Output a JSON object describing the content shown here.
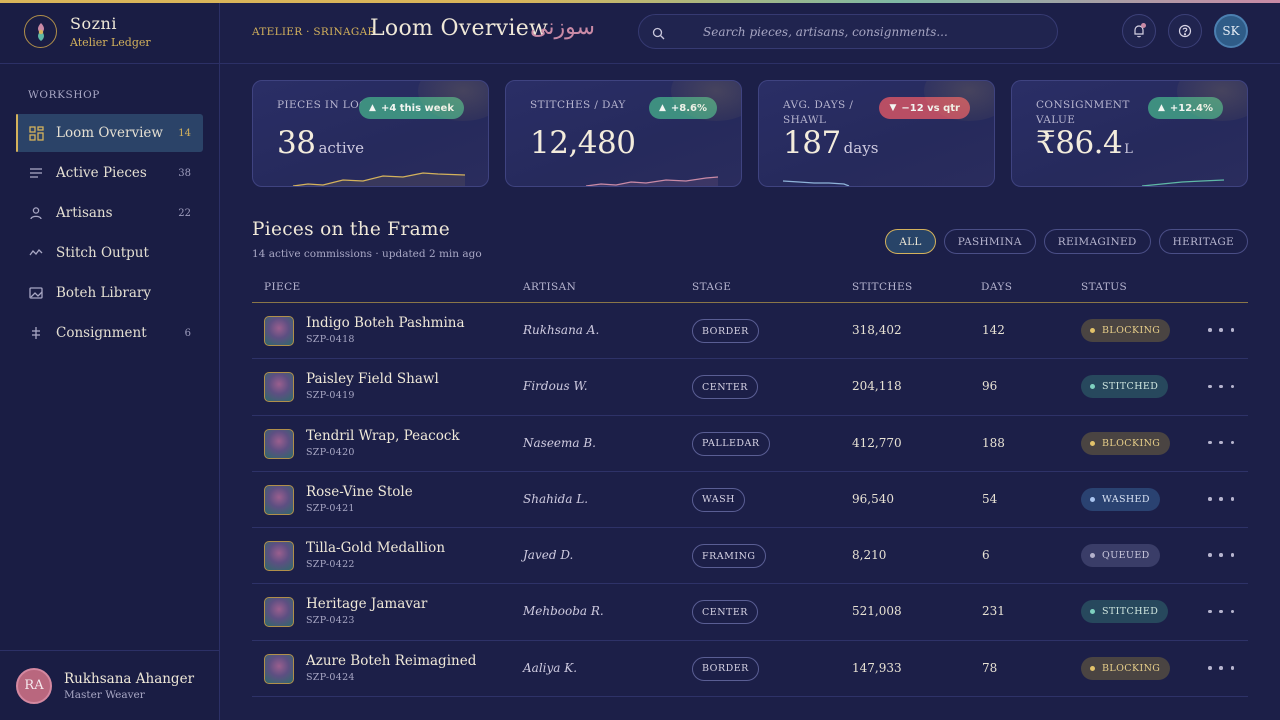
{
  "brand": {
    "name": "Sozni",
    "subtitle": "Atelier Ledger"
  },
  "sidebar": {
    "section": "WORKSHOP",
    "items": [
      {
        "label": "Loom Overview",
        "count": "14",
        "icon": "grid-icon",
        "active": true
      },
      {
        "label": "Active Pieces",
        "count": "38",
        "icon": "list-icon"
      },
      {
        "label": "Artisans",
        "count": "22",
        "icon": "user-icon"
      },
      {
        "label": "Stitch Output",
        "count": "",
        "icon": "wave-icon"
      },
      {
        "label": "Boteh Library",
        "count": "",
        "icon": "image-icon"
      },
      {
        "label": "Consignment",
        "count": "6",
        "icon": "scale-icon"
      }
    ]
  },
  "user": {
    "initials": "RA",
    "name": "Rukhsana Ahanger",
    "role": "Master Weaver"
  },
  "header": {
    "breadcrumb": "ATELIER · SRINAGAR",
    "title": "Loom Overview",
    "title_urdu": "سوزنی",
    "search_placeholder": "Search pieces, artisans, consignments...",
    "avatar_initials": "SK"
  },
  "cards": [
    {
      "label": "PIECES IN LOOM",
      "value": "38",
      "unit": "active",
      "badge": "+4 this week",
      "trend": "up",
      "color": "#d4b25c"
    },
    {
      "label": "STITCHES / DAY",
      "value": "12,480",
      "unit": "",
      "badge": "+8.6%",
      "trend": "up",
      "color": "#c98aa6"
    },
    {
      "label": "AVG. DAYS / SHAWL",
      "value": "187",
      "unit": "days",
      "badge": "−12 vs qtr",
      "trend": "down",
      "color": "#8fb3d9"
    },
    {
      "label": "CONSIGNMENT VALUE",
      "value": "₹86.4",
      "unit": "L",
      "badge": "+12.4%",
      "trend": "up",
      "color": "#5fb8a6"
    }
  ],
  "table": {
    "title": "Pieces on the Frame",
    "subtitle": "14 active commissions · updated 2 min ago",
    "filters": [
      "ALL",
      "PASHMINA",
      "REIMAGINED",
      "HERITAGE"
    ],
    "active_filter": "ALL",
    "columns": [
      "PIECE",
      "ARTISAN",
      "STAGE",
      "STITCHES",
      "DAYS",
      "STATUS"
    ],
    "rows": [
      {
        "name": "Indigo Boteh Pashmina",
        "code": "SZP-0418",
        "artisan": "Rukhsana A.",
        "stage": "BORDER",
        "stitches": "318,402",
        "days": "142",
        "status": "BLOCKING",
        "status_kind": "blocking"
      },
      {
        "name": "Paisley Field Shawl",
        "code": "SZP-0419",
        "artisan": "Firdous W.",
        "stage": "CENTER",
        "stitches": "204,118",
        "days": "96",
        "status": "STITCHED",
        "status_kind": "stitched"
      },
      {
        "name": "Tendril Wrap, Peacock",
        "code": "SZP-0420",
        "artisan": "Naseema B.",
        "stage": "PALLEDAR",
        "stitches": "412,770",
        "days": "188",
        "status": "BLOCKING",
        "status_kind": "blocking"
      },
      {
        "name": "Rose-Vine Stole",
        "code": "SZP-0421",
        "artisan": "Shahida L.",
        "stage": "WASH",
        "stitches": "96,540",
        "days": "54",
        "status": "WASHED",
        "status_kind": "washed"
      },
      {
        "name": "Tilla-Gold Medallion",
        "code": "SZP-0422",
        "artisan": "Javed D.",
        "stage": "FRAMING",
        "stitches": "8,210",
        "days": "6",
        "status": "QUEUED",
        "status_kind": "queued"
      },
      {
        "name": "Heritage Jamavar",
        "code": "SZP-0423",
        "artisan": "Mehbooba R.",
        "stage": "CENTER",
        "stitches": "521,008",
        "days": "231",
        "status": "STITCHED",
        "status_kind": "stitched"
      },
      {
        "name": "Azure Boteh Reimagined",
        "code": "SZP-0424",
        "artisan": "Aaliya K.",
        "stage": "BORDER",
        "stitches": "147,933",
        "days": "78",
        "status": "BLOCKING",
        "status_kind": "blocking"
      }
    ]
  }
}
